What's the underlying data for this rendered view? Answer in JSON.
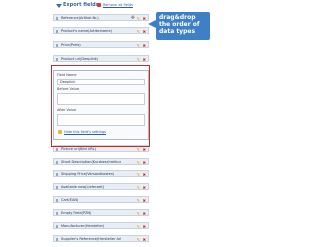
{
  "header": {
    "title": "Export fields",
    "remove_all": "Remove all fields"
  },
  "rows_top": [
    {
      "label": "Reference(Artikel-Nr.)"
    },
    {
      "label": "Product's name(Artikelname)"
    },
    {
      "label": "Price(Preis)"
    },
    {
      "label": "Product url(Deeplink)"
    }
  ],
  "edit_panel": {
    "field_name_label": "Field Name",
    "field_name_value": "Deeplink",
    "before_value_label": "Before Value",
    "after_value_label": "After Value",
    "hide_link": "Hide this field's settings"
  },
  "rows_bottom": [
    {
      "label": "Picture url(Bild URL)"
    },
    {
      "label": "Short Description(Kurzbeschreibung)"
    },
    {
      "label": "Shipping Price(Versandkosten)"
    },
    {
      "label": "Available now(Lieferzeit)"
    },
    {
      "label": "Cart(EAN)"
    },
    {
      "label": "Empty Field(PZN)"
    },
    {
      "label": "Manufacturer(Hersteller)"
    },
    {
      "label": "Supplier's Reference(Hersteller ArtNr)"
    }
  ],
  "callout": {
    "text": "drag&drop the order of data types"
  },
  "icons": {
    "edit": "pencil-icon",
    "delete": "delete-icon",
    "move": "move-icon"
  }
}
